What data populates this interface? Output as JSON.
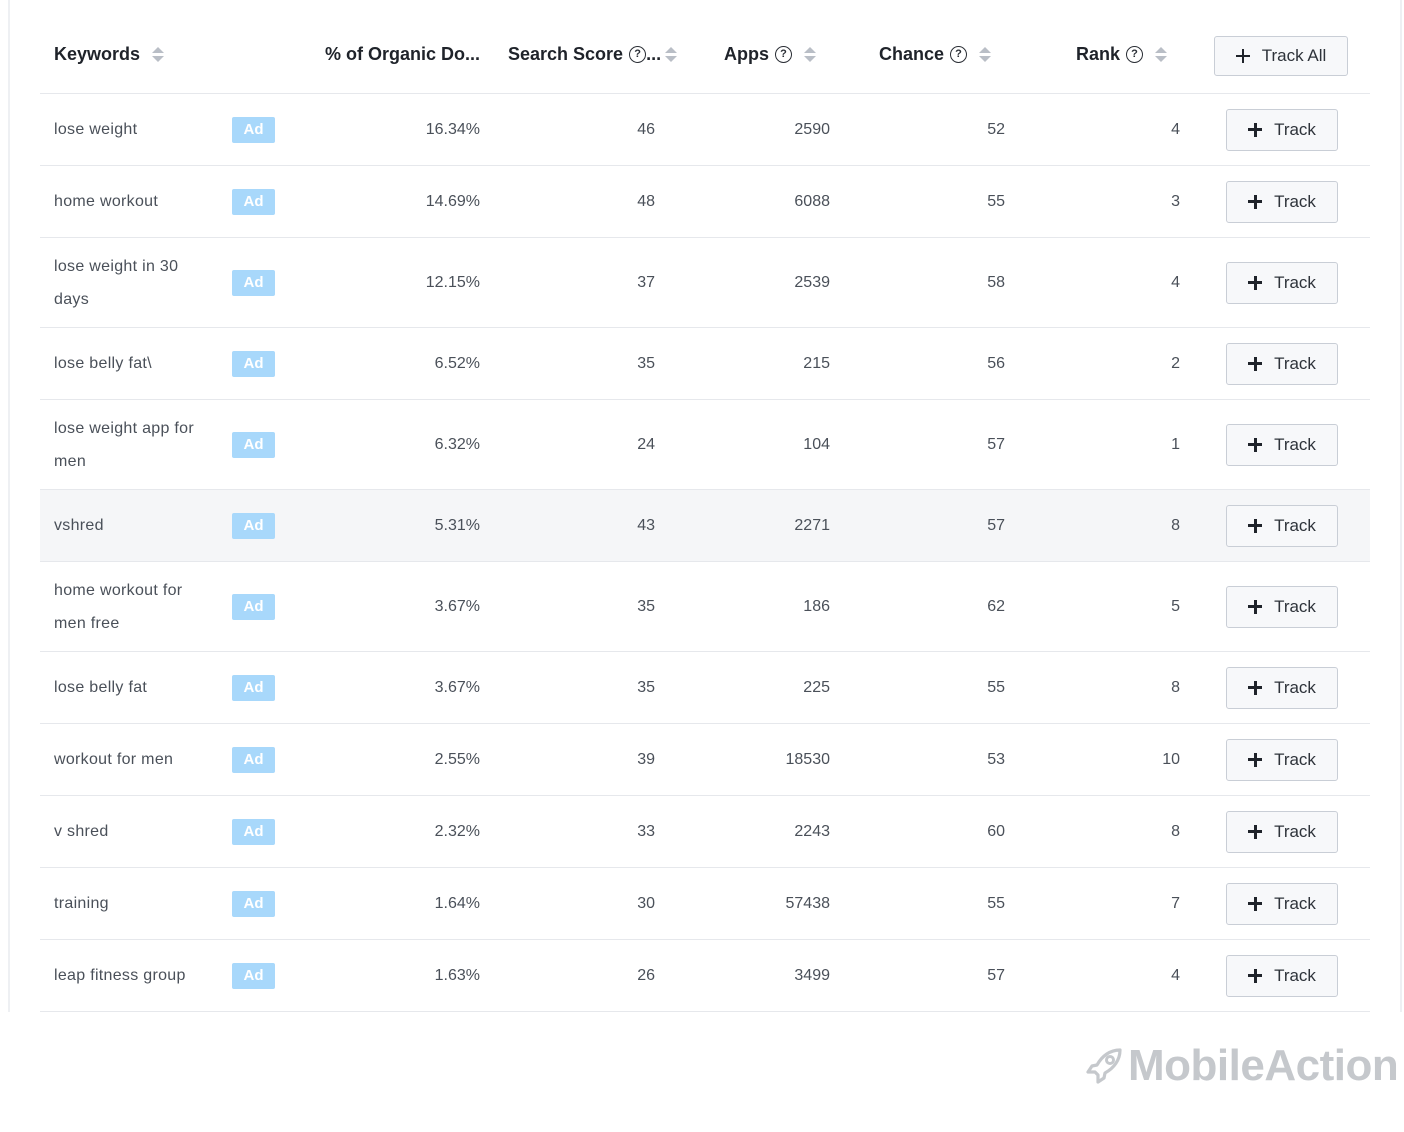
{
  "header": {
    "keywords": "Keywords",
    "organic": "% of Organic Do...",
    "search_score": "Search Score",
    "search_score_suffix": "...",
    "apps": "Apps",
    "chance": "Chance",
    "rank": "Rank",
    "track_all": "Track All"
  },
  "ad_label": "Ad",
  "track_label": "Track",
  "rows": [
    {
      "keyword": "lose weight",
      "organic": "16.34%",
      "score": "46",
      "apps": "2590",
      "chance": "52",
      "rank": "4"
    },
    {
      "keyword": "home workout",
      "organic": "14.69%",
      "score": "48",
      "apps": "6088",
      "chance": "55",
      "rank": "3"
    },
    {
      "keyword": "lose weight in 30 days",
      "organic": "12.15%",
      "score": "37",
      "apps": "2539",
      "chance": "58",
      "rank": "4"
    },
    {
      "keyword": "lose belly fat\\",
      "organic": "6.52%",
      "score": "35",
      "apps": "215",
      "chance": "56",
      "rank": "2"
    },
    {
      "keyword": "lose weight app for men",
      "organic": "6.32%",
      "score": "24",
      "apps": "104",
      "chance": "57",
      "rank": "1"
    },
    {
      "keyword": "vshred",
      "organic": "5.31%",
      "score": "43",
      "apps": "2271",
      "chance": "57",
      "rank": "8"
    },
    {
      "keyword": "home workout for men free",
      "organic": "3.67%",
      "score": "35",
      "apps": "186",
      "chance": "62",
      "rank": "5"
    },
    {
      "keyword": "lose belly fat",
      "organic": "3.67%",
      "score": "35",
      "apps": "225",
      "chance": "55",
      "rank": "8"
    },
    {
      "keyword": "workout for men",
      "organic": "2.55%",
      "score": "39",
      "apps": "18530",
      "chance": "53",
      "rank": "10"
    },
    {
      "keyword": "v shred",
      "organic": "2.32%",
      "score": "33",
      "apps": "2243",
      "chance": "60",
      "rank": "8"
    },
    {
      "keyword": "training",
      "organic": "1.64%",
      "score": "30",
      "apps": "57438",
      "chance": "55",
      "rank": "7"
    },
    {
      "keyword": "leap fitness group",
      "organic": "1.63%",
      "score": "26",
      "apps": "3499",
      "chance": "57",
      "rank": "4"
    }
  ],
  "brand": {
    "name": "MobileAction",
    "ad_color": "#a8d8fb",
    "logo_color": "#c5c8cc"
  }
}
